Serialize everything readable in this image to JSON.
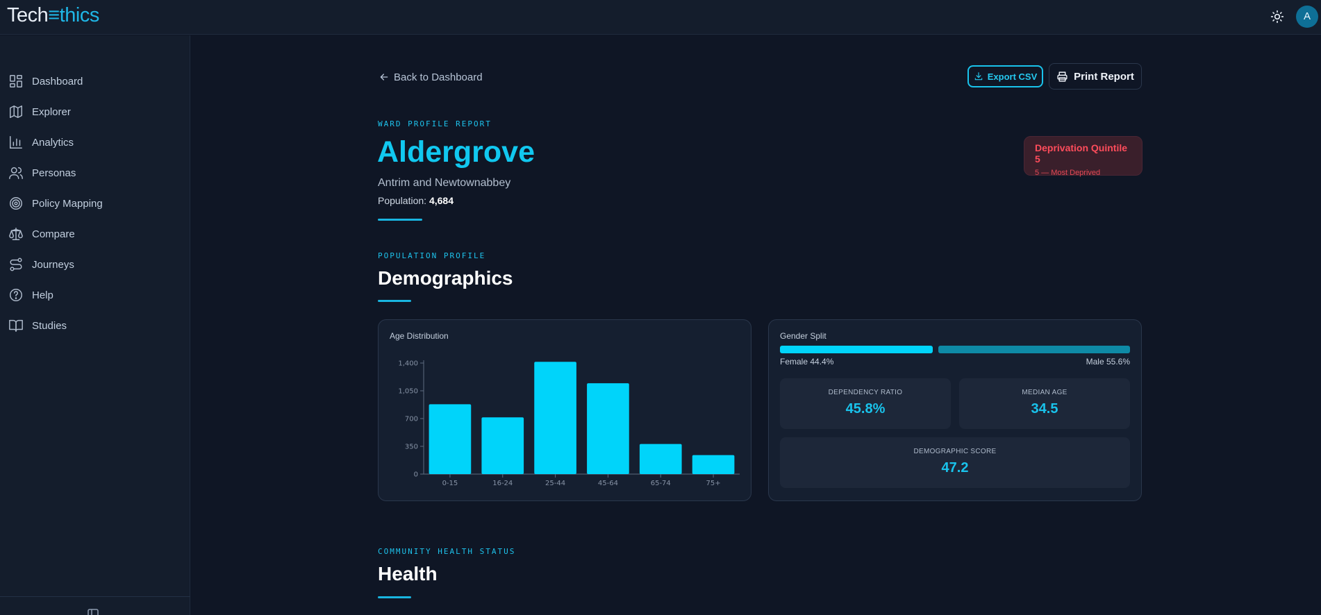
{
  "app": {
    "logo_part1": "Tech",
    "logo_part2": "≡thics",
    "avatar_initial": "A"
  },
  "sidebar": {
    "items": [
      {
        "label": "Dashboard",
        "icon": "dashboard-icon"
      },
      {
        "label": "Explorer",
        "icon": "map-icon"
      },
      {
        "label": "Analytics",
        "icon": "bar-chart-icon"
      },
      {
        "label": "Personas",
        "icon": "users-icon"
      },
      {
        "label": "Policy Mapping",
        "icon": "target-icon"
      },
      {
        "label": "Compare",
        "icon": "scale-icon"
      },
      {
        "label": "Journeys",
        "icon": "route-icon"
      },
      {
        "label": "Help",
        "icon": "help-circle-icon"
      },
      {
        "label": "Studies",
        "icon": "book-open-icon"
      }
    ]
  },
  "toolbar": {
    "back_label": "Back to Dashboard",
    "export_label": "Export CSV",
    "print_label": "Print Report"
  },
  "ward": {
    "eyebrow": "WARD PROFILE REPORT",
    "name": "Aldergrove",
    "council": "Antrim and Newtownabbey",
    "population_label": "Population:",
    "population_value": "4,684",
    "quintile_title": "Deprivation Quintile 5",
    "quintile_sub": "5 — Most Deprived"
  },
  "demographics": {
    "eyebrow": "POPULATION PROFILE",
    "title": "Demographics",
    "age_card_title": "Age Distribution",
    "gender_card_title": "Gender Split",
    "female_label": "Female 44.4%",
    "male_label": "Male 55.6%",
    "female_share": 0.444,
    "male_share": 0.556,
    "dependency_label": "DEPENDENCY RATIO",
    "dependency_value": "45.8%",
    "median_age_label": "MEDIAN AGE",
    "median_age_value": "34.5",
    "score_label": "DEMOGRAPHIC SCORE",
    "score_value": "47.2"
  },
  "health": {
    "eyebrow": "COMMUNITY HEALTH STATUS",
    "title": "Health"
  },
  "colors": {
    "accent": "#19c3ec",
    "bar": "#00d4fa",
    "male_bar": "#0e8aa6",
    "danger": "#ff4c5b",
    "background": "#0f1625",
    "panel": "#151f30"
  },
  "chart_data": {
    "type": "bar",
    "categories": [
      "0-15",
      "16-24",
      "25-44",
      "45-64",
      "65-74",
      "75+"
    ],
    "values": [
      880,
      715,
      1415,
      1145,
      380,
      240
    ],
    "yticks": [
      "0",
      "350",
      "700",
      "1,050",
      "1,400"
    ],
    "ytick_values": [
      0,
      350,
      700,
      1050,
      1400
    ],
    "ylim": [
      0,
      1400
    ],
    "grid": false
  }
}
